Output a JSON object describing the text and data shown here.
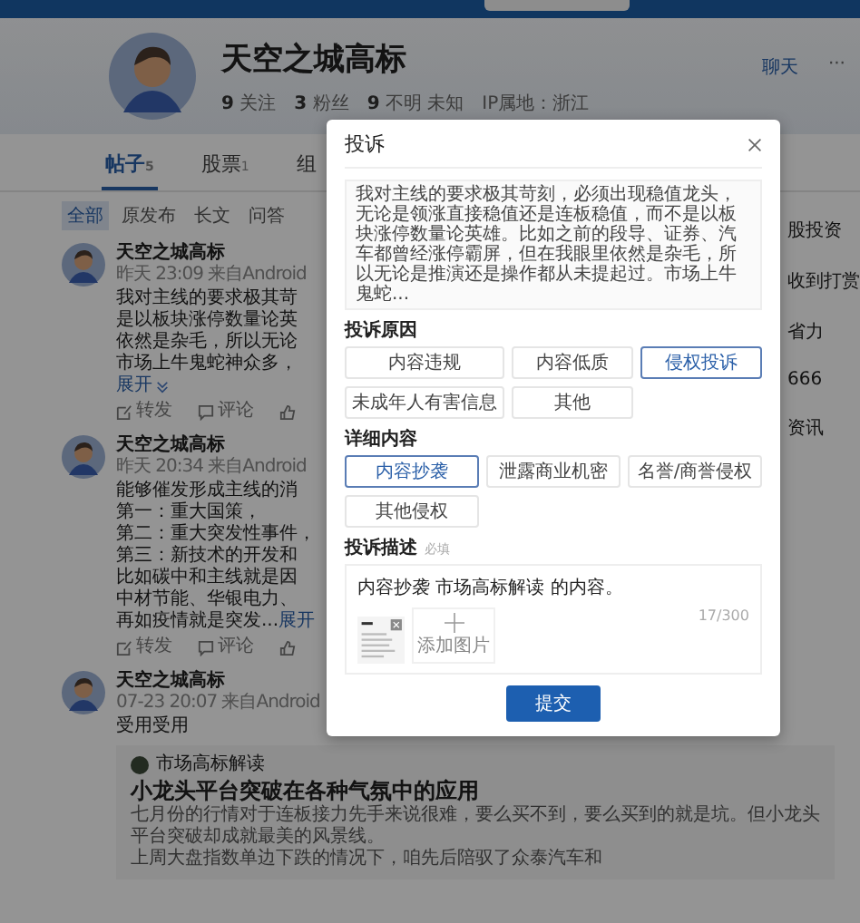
{
  "profile": {
    "name": "天空之城高标",
    "stats": [
      {
        "count": "9",
        "label": "关注"
      },
      {
        "count": "3",
        "label": "粉丝"
      },
      {
        "count": "9",
        "label": "不明 未知"
      }
    ],
    "ip": "IP属地：浙江",
    "chat": "聊天",
    "more": "···"
  },
  "tabs": [
    {
      "label": "帖子",
      "count": "5",
      "selected": true
    },
    {
      "label": "股票",
      "count": "1",
      "selected": false
    },
    {
      "label": "组",
      "selected": false
    }
  ],
  "filters": [
    {
      "label": "全部",
      "selected": true
    },
    {
      "label": "原发布",
      "selected": false
    },
    {
      "label": "长文",
      "selected": false
    },
    {
      "label": "问答",
      "selected": false
    }
  ],
  "posts": [
    {
      "author": "天空之城高标",
      "meta": "昨天 23:09 来自Android",
      "lines": [
        "我对主线的要求极其苛",
        "是以板块涨停数量论英",
        "依然是杂毛，所以无论",
        "市场上牛鬼蛇神众多，"
      ],
      "expand": "展开",
      "actions": [
        "转发",
        "评论"
      ]
    },
    {
      "author": "天空之城高标",
      "meta": "昨天 20:34 来自Android",
      "lines": [
        "能够催发形成主线的消",
        "第一：重大国策，",
        "第二：重大突发性事件，",
        "第三：新技术的开发和",
        "比如碳中和主线就是因",
        "中材节能、华银电力、",
        "再如疫情就是突发..."
      ],
      "expand": "展开",
      "actions": [
        "转发",
        "评论"
      ]
    },
    {
      "author": "天空之城高标",
      "meta": "07-23 20:07 来自Android",
      "lines": [
        "受用受用"
      ],
      "quote": {
        "source": "市场高标解读",
        "title": "小龙头平台突破在各种气氛中的应用",
        "lines": [
          "七月份的行情对于连板接力先手来说很难，要么买不到，要么买到的就是坑。但小龙头",
          "平台突破却成就最美的风景线。",
          "上周大盘指数单边下跌的情况下，咱先后陪驭了众泰汽车和"
        ]
      }
    }
  ],
  "sidebar": [
    "股投资",
    "收到打赏",
    "省力",
    "666",
    "资讯"
  ],
  "dialog": {
    "title": "投诉",
    "quote": "我对主线的要求极其苛刻，必须出现稳值龙头，无论是领涨直接稳值还是连板稳值，而不是以板块涨停数量论英雄。比如之前的段导、证券、汽车都曾经涨停霸屏，但在我眼里依然是杂毛，所以无论是推演还是操作都从未提起过。市场上牛鬼蛇...",
    "reason_heading": "投诉原因",
    "reasons": [
      {
        "label": "内容违规",
        "selected": false
      },
      {
        "label": "内容低质",
        "selected": false
      },
      {
        "label": "侵权投诉",
        "selected": true
      },
      {
        "label": "未成年人有害信息",
        "selected": false
      },
      {
        "label": "其他",
        "selected": false
      }
    ],
    "detail_heading": "详细内容",
    "details": [
      {
        "label": "内容抄袭",
        "selected": true
      },
      {
        "label": "泄露商业机密",
        "selected": false
      },
      {
        "label": "名誉/商誉侵权",
        "selected": false
      },
      {
        "label": "其他侵权",
        "selected": false
      }
    ],
    "description_heading": "投诉描述",
    "required": "必填",
    "description": "内容抄袭 市场高标解读 的内容。",
    "counter": "17/300",
    "add_image": "添加图片",
    "submit": "提交"
  }
}
